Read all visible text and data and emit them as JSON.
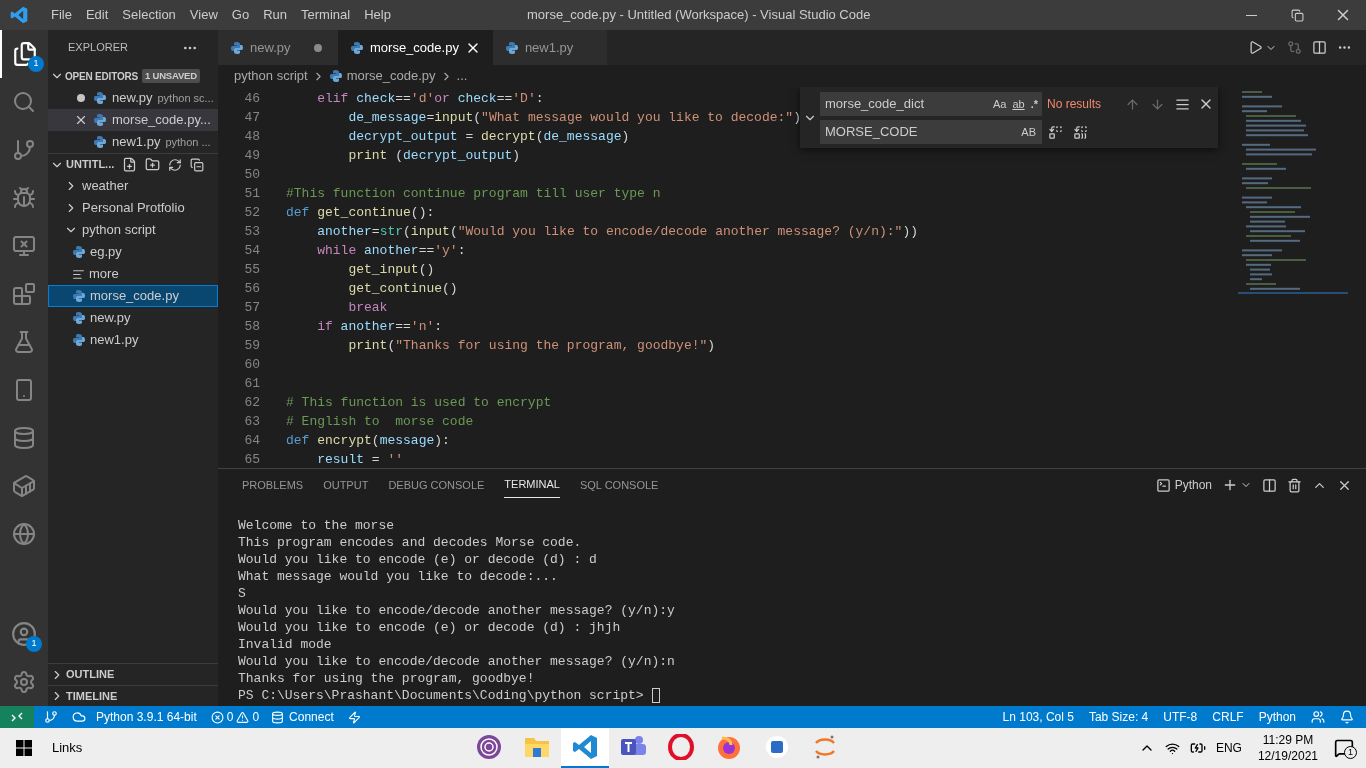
{
  "title_bar": {
    "menu": [
      "File",
      "Edit",
      "Selection",
      "View",
      "Go",
      "Run",
      "Terminal",
      "Help"
    ],
    "title": "morse_code.py - Untitled (Workspace) - Visual Studio Code"
  },
  "activity_bar": {
    "explorer_badge": "1",
    "accounts_badge": "1"
  },
  "sidebar": {
    "title": "EXPLORER",
    "open_editors": {
      "label": "OPEN EDITORS",
      "badge": "1 UNSAVED",
      "expanded": true,
      "items": [
        {
          "name": "new.py",
          "detail": "python sc...",
          "unsaved": true,
          "selected": false
        },
        {
          "name": "morse_code.py...",
          "unsaved": false,
          "selected": true
        },
        {
          "name": "new1.py",
          "detail": "python ...",
          "unsaved": false,
          "selected": false
        }
      ]
    },
    "workspace": {
      "label": "UNTITL...",
      "expanded": true,
      "tree": [
        {
          "name": "weather",
          "kind": "folder",
          "expanded": false,
          "selected": false
        },
        {
          "name": "Personal Protfolio",
          "kind": "folder",
          "expanded": false,
          "selected": false
        },
        {
          "name": "python script",
          "kind": "folder",
          "expanded": true,
          "selected": false,
          "children": [
            {
              "name": "eg.py",
              "kind": "python",
              "selected": false
            },
            {
              "name": "more",
              "kind": "text",
              "selected": false
            },
            {
              "name": "morse_code.py",
              "kind": "python",
              "selected": true
            },
            {
              "name": "new.py",
              "kind": "python",
              "selected": false
            },
            {
              "name": "new1.py",
              "kind": "python",
              "selected": false
            }
          ]
        }
      ]
    },
    "outline": "OUTLINE",
    "timeline": "TIMELINE"
  },
  "tabs": [
    {
      "label": "new.py",
      "selected": false,
      "unsaved": true
    },
    {
      "label": "morse_code.py",
      "selected": true,
      "unsaved": false
    },
    {
      "label": "new1.py",
      "selected": false,
      "unsaved": false
    }
  ],
  "breadcrumb": [
    "python script",
    "morse_code.py",
    "..."
  ],
  "find_widget": {
    "expanded": true,
    "query": "morse_code_dict",
    "options": [
      "Aa",
      "ab",
      ".*"
    ],
    "result": "No results",
    "replace": "MORSE_CODE",
    "replace_option": "AB"
  },
  "code": [
    {
      "number": "46",
      "tokens": [
        {
          "kind": "control",
          "text": "    elif"
        },
        {
          "kind": "variable",
          "text": " check"
        },
        {
          "kind": "plain",
          "text": "=="
        },
        {
          "kind": "string",
          "text": "'d'"
        },
        {
          "kind": "control",
          "text": "or"
        },
        {
          "kind": "variable",
          "text": " check"
        },
        {
          "kind": "plain",
          "text": "=="
        },
        {
          "kind": "string",
          "text": "'D'"
        },
        {
          "kind": "plain",
          "text": ":"
        }
      ]
    },
    {
      "number": "47",
      "tokens": [
        {
          "kind": "variable",
          "text": "        de_message"
        },
        {
          "kind": "plain",
          "text": "="
        },
        {
          "kind": "function",
          "text": "input"
        },
        {
          "kind": "plain",
          "text": "("
        },
        {
          "kind": "string",
          "text": "\"What message would you like to decode:\""
        },
        {
          "kind": "plain",
          "text": ")"
        }
      ]
    },
    {
      "number": "48",
      "tokens": [
        {
          "kind": "variable",
          "text": "        decrypt_output"
        },
        {
          "kind": "plain",
          "text": " = "
        },
        {
          "kind": "function",
          "text": "decrypt"
        },
        {
          "kind": "plain",
          "text": "("
        },
        {
          "kind": "variable",
          "text": "de_message"
        },
        {
          "kind": "plain",
          "text": ")"
        }
      ]
    },
    {
      "number": "49",
      "tokens": [
        {
          "kind": "function",
          "text": "        print"
        },
        {
          "kind": "plain",
          "text": " ("
        },
        {
          "kind": "variable",
          "text": "decrypt_output"
        },
        {
          "kind": "plain",
          "text": ")"
        }
      ]
    },
    {
      "number": "50"
    },
    {
      "number": "51",
      "tokens": [
        {
          "kind": "comment",
          "text": "#This function continue program till user type n"
        }
      ]
    },
    {
      "number": "52",
      "tokens": [
        {
          "kind": "keyword",
          "text": "def"
        },
        {
          "kind": "function",
          "text": " get_continue"
        },
        {
          "kind": "plain",
          "text": "():"
        }
      ]
    },
    {
      "number": "53",
      "tokens": [
        {
          "kind": "variable",
          "text": "    another"
        },
        {
          "kind": "plain",
          "text": "="
        },
        {
          "kind": "type",
          "text": "str"
        },
        {
          "kind": "plain",
          "text": "("
        },
        {
          "kind": "function",
          "text": "input"
        },
        {
          "kind": "plain",
          "text": "("
        },
        {
          "kind": "string",
          "text": "\"Would you like to encode/decode another message? (y/n):\""
        },
        {
          "kind": "plain",
          "text": "))"
        }
      ]
    },
    {
      "number": "54",
      "tokens": [
        {
          "kind": "control",
          "text": "    while"
        },
        {
          "kind": "variable",
          "text": " another"
        },
        {
          "kind": "plain",
          "text": "=="
        },
        {
          "kind": "string",
          "text": "'y'"
        },
        {
          "kind": "plain",
          "text": ":"
        }
      ]
    },
    {
      "number": "55",
      "tokens": [
        {
          "kind": "function",
          "text": "        get_input"
        },
        {
          "kind": "plain",
          "text": "()"
        }
      ]
    },
    {
      "number": "56",
      "tokens": [
        {
          "kind": "function",
          "text": "        get_continue"
        },
        {
          "kind": "plain",
          "text": "()"
        }
      ]
    },
    {
      "number": "57",
      "tokens": [
        {
          "kind": "control",
          "text": "        break"
        }
      ]
    },
    {
      "number": "58",
      "tokens": [
        {
          "kind": "control",
          "text": "    if"
        },
        {
          "kind": "variable",
          "text": " another"
        },
        {
          "kind": "plain",
          "text": "=="
        },
        {
          "kind": "string",
          "text": "'n'"
        },
        {
          "kind": "plain",
          "text": ":"
        }
      ]
    },
    {
      "number": "59",
      "tokens": [
        {
          "kind": "function",
          "text": "        print"
        },
        {
          "kind": "plain",
          "text": "("
        },
        {
          "kind": "string",
          "text": "\"Thanks for using the program, goodbye!\""
        },
        {
          "kind": "plain",
          "text": ")"
        }
      ]
    },
    {
      "number": "60"
    },
    {
      "number": "61"
    },
    {
      "number": "62",
      "tokens": [
        {
          "kind": "comment",
          "text": "# This function is used to encrypt"
        }
      ]
    },
    {
      "number": "63",
      "tokens": [
        {
          "kind": "comment",
          "text": "# English to  morse code"
        }
      ]
    },
    {
      "number": "64",
      "tokens": [
        {
          "kind": "keyword",
          "text": "def"
        },
        {
          "kind": "function",
          "text": " encrypt"
        },
        {
          "kind": "plain",
          "text": "("
        },
        {
          "kind": "variable",
          "text": "message"
        },
        {
          "kind": "plain",
          "text": "):"
        }
      ]
    },
    {
      "number": "65",
      "tokens": [
        {
          "kind": "variable",
          "text": "    result"
        },
        {
          "kind": "plain",
          "text": " = "
        },
        {
          "kind": "string",
          "text": "''"
        }
      ]
    }
  ],
  "panel": {
    "tabs": [
      {
        "label": "PROBLEMS",
        "selected": false
      },
      {
        "label": "OUTPUT",
        "selected": false
      },
      {
        "label": "DEBUG CONSOLE",
        "selected": false
      },
      {
        "label": "TERMINAL",
        "selected": true
      },
      {
        "label": "SQL CONSOLE",
        "selected": false
      }
    ],
    "terminal_profile": "Python",
    "terminal_lines": [
      "Welcome to the morse",
      "This program encodes and decodes Morse code.",
      "Would you like to encode (e) or decode (d) : d",
      "What message would you like to decode:...",
      "S",
      "Would you like to encode/decode another message? (y/n):y",
      "Would you like to encode (e) or decode (d) : jhjh",
      "Invalid mode",
      "Would you like to encode/decode another message? (y/n):n",
      "Thanks for using the program, goodbye!"
    ],
    "prompt": "PS C:\\Users\\Prashant\\Documents\\Coding\\python script>"
  },
  "status_bar": {
    "interpreter": "Python 3.9.1 64-bit",
    "errors": "0",
    "warnings": "0",
    "connect": "Connect",
    "right": [
      "Ln 103, Col 5",
      "Tab Size: 4",
      "UTF-8",
      "CRLF",
      "Python"
    ]
  },
  "taskbar": {
    "search": "Links",
    "apps": [
      {
        "kind": "onion",
        "selected": false
      },
      {
        "kind": "folder",
        "selected": false
      },
      {
        "kind": "code",
        "selected": true
      },
      {
        "kind": "teams",
        "selected": false
      },
      {
        "kind": "opera",
        "selected": false
      },
      {
        "kind": "firefox",
        "selected": false
      },
      {
        "kind": "badge",
        "selected": false
      },
      {
        "kind": "orbit",
        "selected": false
      }
    ],
    "language": "ENG",
    "time": "11:29 PM",
    "date": "12/19/2021",
    "notifications": "1"
  }
}
